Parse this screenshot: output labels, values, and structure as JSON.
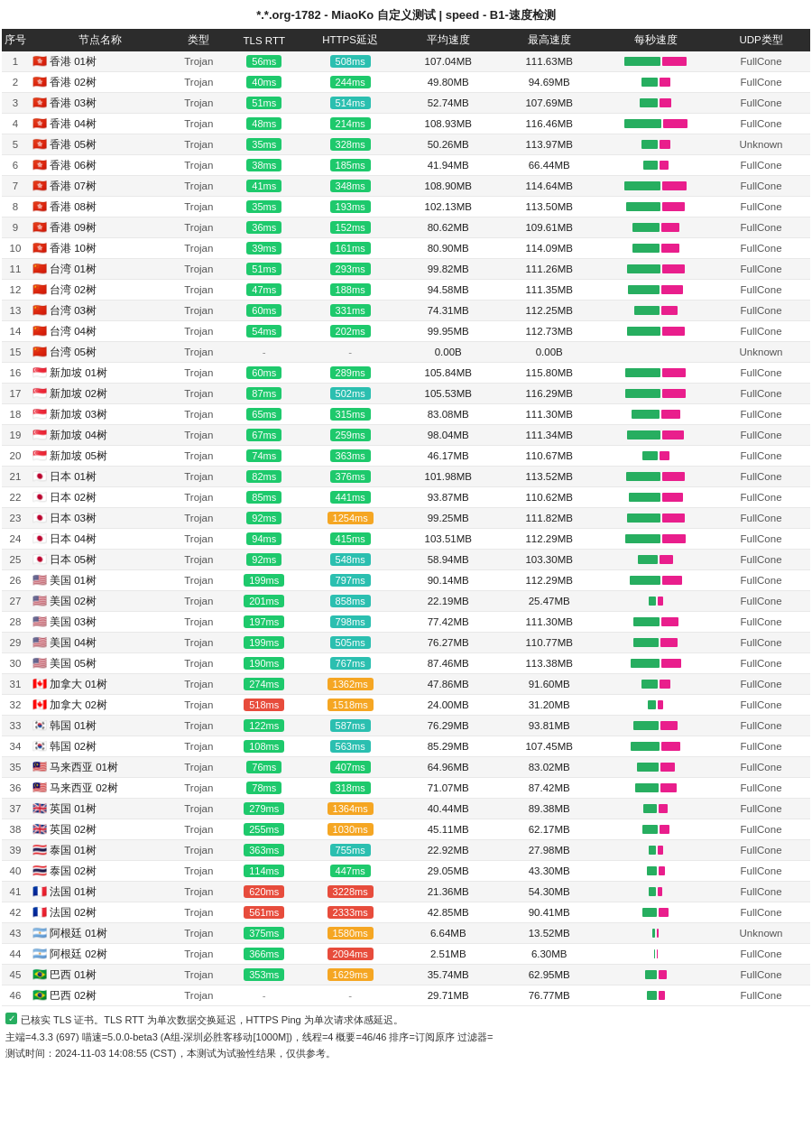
{
  "title": "*.*.org-1782 - MiaoKo 自定义测试 | speed - B1-速度检测",
  "columns": [
    "序号",
    "节点名称",
    "类型",
    "TLS RTT",
    "HTTPS延迟",
    "平均速度",
    "最高速度",
    "每秒速度",
    "UDP类型"
  ],
  "rows": [
    {
      "index": 1,
      "flag": "🇭🇰",
      "name": "香港 01树",
      "type": "Trojan",
      "tls": "56ms",
      "tlsColor": "green",
      "https": "508ms",
      "httpsColor": "teal",
      "avg": "107.04MB",
      "max": "111.63MB",
      "udp": "FullCone",
      "speedRatio": 0.95
    },
    {
      "index": 2,
      "flag": "🇭🇰",
      "name": "香港 02树",
      "type": "Trojan",
      "tls": "40ms",
      "tlsColor": "green",
      "https": "244ms",
      "httpsColor": "green",
      "avg": "49.80MB",
      "max": "94.69MB",
      "udp": "FullCone",
      "speedRatio": 0.43
    },
    {
      "index": 3,
      "flag": "🇭🇰",
      "name": "香港 03树",
      "type": "Trojan",
      "tls": "51ms",
      "tlsColor": "green",
      "https": "514ms",
      "httpsColor": "teal",
      "avg": "52.74MB",
      "max": "107.69MB",
      "udp": "FullCone",
      "speedRatio": 0.47
    },
    {
      "index": 4,
      "flag": "🇭🇰",
      "name": "香港 04树",
      "type": "Trojan",
      "tls": "48ms",
      "tlsColor": "green",
      "https": "214ms",
      "httpsColor": "green",
      "avg": "108.93MB",
      "max": "116.46MB",
      "udp": "FullCone",
      "speedRatio": 0.97
    },
    {
      "index": 5,
      "flag": "🇭🇰",
      "name": "香港 05树",
      "type": "Trojan",
      "tls": "35ms",
      "tlsColor": "green",
      "https": "328ms",
      "httpsColor": "green",
      "avg": "50.26MB",
      "max": "113.97MB",
      "udp": "Unknown",
      "speedRatio": 0.44
    },
    {
      "index": 6,
      "flag": "🇭🇰",
      "name": "香港 06树",
      "type": "Trojan",
      "tls": "38ms",
      "tlsColor": "green",
      "https": "185ms",
      "httpsColor": "green",
      "avg": "41.94MB",
      "max": "66.44MB",
      "udp": "FullCone",
      "speedRatio": 0.37
    },
    {
      "index": 7,
      "flag": "🇭🇰",
      "name": "香港 07树",
      "type": "Trojan",
      "tls": "41ms",
      "tlsColor": "green",
      "https": "348ms",
      "httpsColor": "green",
      "avg": "108.90MB",
      "max": "114.64MB",
      "udp": "FullCone",
      "speedRatio": 0.96
    },
    {
      "index": 8,
      "flag": "🇭🇰",
      "name": "香港 08树",
      "type": "Trojan",
      "tls": "35ms",
      "tlsColor": "green",
      "https": "193ms",
      "httpsColor": "green",
      "avg": "102.13MB",
      "max": "113.50MB",
      "udp": "FullCone",
      "speedRatio": 0.9
    },
    {
      "index": 9,
      "flag": "🇭🇰",
      "name": "香港 09树",
      "type": "Trojan",
      "tls": "36ms",
      "tlsColor": "green",
      "https": "152ms",
      "httpsColor": "green",
      "avg": "80.62MB",
      "max": "109.61MB",
      "udp": "FullCone",
      "speedRatio": 0.71
    },
    {
      "index": 10,
      "flag": "🇭🇰",
      "name": "香港 10树",
      "type": "Trojan",
      "tls": "39ms",
      "tlsColor": "green",
      "https": "161ms",
      "httpsColor": "green",
      "avg": "80.90MB",
      "max": "114.09MB",
      "udp": "FullCone",
      "speedRatio": 0.72
    },
    {
      "index": 11,
      "flag": "🇨🇳",
      "name": "台湾 01树",
      "type": "Trojan",
      "tls": "51ms",
      "tlsColor": "green",
      "https": "293ms",
      "httpsColor": "green",
      "avg": "99.82MB",
      "max": "111.26MB",
      "udp": "FullCone",
      "speedRatio": 0.88
    },
    {
      "index": 12,
      "flag": "🇨🇳",
      "name": "台湾 02树",
      "type": "Trojan",
      "tls": "47ms",
      "tlsColor": "green",
      "https": "188ms",
      "httpsColor": "green",
      "avg": "94.58MB",
      "max": "111.35MB",
      "udp": "FullCone",
      "speedRatio": 0.84
    },
    {
      "index": 13,
      "flag": "🇨🇳",
      "name": "台湾 03树",
      "type": "Trojan",
      "tls": "60ms",
      "tlsColor": "green",
      "https": "331ms",
      "httpsColor": "green",
      "avg": "74.31MB",
      "max": "112.25MB",
      "udp": "FullCone",
      "speedRatio": 0.66
    },
    {
      "index": 14,
      "flag": "🇨🇳",
      "name": "台湾 04树",
      "type": "Trojan",
      "tls": "54ms",
      "tlsColor": "green",
      "https": "202ms",
      "httpsColor": "green",
      "avg": "99.95MB",
      "max": "112.73MB",
      "udp": "FullCone",
      "speedRatio": 0.89
    },
    {
      "index": 15,
      "flag": "🇨🇳",
      "name": "台湾 05树",
      "type": "Trojan",
      "tls": "-",
      "tlsColor": "dash",
      "https": "-",
      "httpsColor": "dash",
      "avg": "0.00B",
      "max": "0.00B",
      "udp": "Unknown",
      "speedRatio": 0
    },
    {
      "index": 16,
      "flag": "🇸🇬",
      "name": "新加坡 01树",
      "type": "Trojan",
      "tls": "60ms",
      "tlsColor": "green",
      "https": "289ms",
      "httpsColor": "green",
      "avg": "105.84MB",
      "max": "115.80MB",
      "udp": "FullCone",
      "speedRatio": 0.94
    },
    {
      "index": 17,
      "flag": "🇸🇬",
      "name": "新加坡 02树",
      "type": "Trojan",
      "tls": "87ms",
      "tlsColor": "green",
      "https": "502ms",
      "httpsColor": "teal",
      "avg": "105.53MB",
      "max": "116.29MB",
      "udp": "FullCone",
      "speedRatio": 0.93
    },
    {
      "index": 18,
      "flag": "🇸🇬",
      "name": "新加坡 03树",
      "type": "Trojan",
      "tls": "65ms",
      "tlsColor": "green",
      "https": "315ms",
      "httpsColor": "green",
      "avg": "83.08MB",
      "max": "111.30MB",
      "udp": "FullCone",
      "speedRatio": 0.74
    },
    {
      "index": 19,
      "flag": "🇸🇬",
      "name": "新加坡 04树",
      "type": "Trojan",
      "tls": "67ms",
      "tlsColor": "green",
      "https": "259ms",
      "httpsColor": "green",
      "avg": "98.04MB",
      "max": "111.34MB",
      "udp": "FullCone",
      "speedRatio": 0.87
    },
    {
      "index": 20,
      "flag": "🇸🇬",
      "name": "新加坡 05树",
      "type": "Trojan",
      "tls": "74ms",
      "tlsColor": "green",
      "https": "363ms",
      "httpsColor": "green",
      "avg": "46.17MB",
      "max": "110.67MB",
      "udp": "FullCone",
      "speedRatio": 0.41
    },
    {
      "index": 21,
      "flag": "🇯🇵",
      "name": "日本 01树",
      "type": "Trojan",
      "tls": "82ms",
      "tlsColor": "green",
      "https": "376ms",
      "httpsColor": "green",
      "avg": "101.98MB",
      "max": "113.52MB",
      "udp": "FullCone",
      "speedRatio": 0.9
    },
    {
      "index": 22,
      "flag": "🇯🇵",
      "name": "日本 02树",
      "type": "Trojan",
      "tls": "85ms",
      "tlsColor": "green",
      "https": "441ms",
      "httpsColor": "green",
      "avg": "93.87MB",
      "max": "110.62MB",
      "udp": "FullCone",
      "speedRatio": 0.83
    },
    {
      "index": 23,
      "flag": "🇯🇵",
      "name": "日本 03树",
      "type": "Trojan",
      "tls": "92ms",
      "tlsColor": "green",
      "https": "1254ms",
      "httpsColor": "orange",
      "avg": "99.25MB",
      "max": "111.82MB",
      "udp": "FullCone",
      "speedRatio": 0.88
    },
    {
      "index": 24,
      "flag": "🇯🇵",
      "name": "日本 04树",
      "type": "Trojan",
      "tls": "94ms",
      "tlsColor": "green",
      "https": "415ms",
      "httpsColor": "green",
      "avg": "103.51MB",
      "max": "112.29MB",
      "udp": "FullCone",
      "speedRatio": 0.92
    },
    {
      "index": 25,
      "flag": "🇯🇵",
      "name": "日本 05树",
      "type": "Trojan",
      "tls": "92ms",
      "tlsColor": "green",
      "https": "548ms",
      "httpsColor": "teal",
      "avg": "58.94MB",
      "max": "103.30MB",
      "udp": "FullCone",
      "speedRatio": 0.52
    },
    {
      "index": 26,
      "flag": "🇺🇸",
      "name": "美国 01树",
      "type": "Trojan",
      "tls": "199ms",
      "tlsColor": "green",
      "https": "797ms",
      "httpsColor": "teal",
      "avg": "90.14MB",
      "max": "112.29MB",
      "udp": "FullCone",
      "speedRatio": 0.8
    },
    {
      "index": 27,
      "flag": "🇺🇸",
      "name": "美国 02树",
      "type": "Trojan",
      "tls": "201ms",
      "tlsColor": "green",
      "https": "858ms",
      "httpsColor": "teal",
      "avg": "22.19MB",
      "max": "25.47MB",
      "udp": "FullCone",
      "speedRatio": 0.2
    },
    {
      "index": 28,
      "flag": "🇺🇸",
      "name": "美国 03树",
      "type": "Trojan",
      "tls": "197ms",
      "tlsColor": "green",
      "https": "798ms",
      "httpsColor": "teal",
      "avg": "77.42MB",
      "max": "111.30MB",
      "udp": "FullCone",
      "speedRatio": 0.68
    },
    {
      "index": 29,
      "flag": "🇺🇸",
      "name": "美国 04树",
      "type": "Trojan",
      "tls": "199ms",
      "tlsColor": "green",
      "https": "505ms",
      "httpsColor": "teal",
      "avg": "76.27MB",
      "max": "110.77MB",
      "udp": "FullCone",
      "speedRatio": 0.67
    },
    {
      "index": 30,
      "flag": "🇺🇸",
      "name": "美国 05树",
      "type": "Trojan",
      "tls": "190ms",
      "tlsColor": "green",
      "https": "767ms",
      "httpsColor": "teal",
      "avg": "87.46MB",
      "max": "113.38MB",
      "udp": "FullCone",
      "speedRatio": 0.77
    },
    {
      "index": 31,
      "flag": "🇨🇦",
      "name": "加拿大 01树",
      "type": "Trojan",
      "tls": "274ms",
      "tlsColor": "green",
      "https": "1362ms",
      "httpsColor": "orange",
      "avg": "47.86MB",
      "max": "91.60MB",
      "udp": "FullCone",
      "speedRatio": 0.42
    },
    {
      "index": 32,
      "flag": "🇨🇦",
      "name": "加拿大 02树",
      "type": "Trojan",
      "tls": "518ms",
      "tlsColor": "red",
      "https": "1518ms",
      "httpsColor": "orange",
      "avg": "24.00MB",
      "max": "31.20MB",
      "udp": "FullCone",
      "speedRatio": 0.21
    },
    {
      "index": 33,
      "flag": "🇰🇷",
      "name": "韩国 01树",
      "type": "Trojan",
      "tls": "122ms",
      "tlsColor": "green",
      "https": "587ms",
      "httpsColor": "teal",
      "avg": "76.29MB",
      "max": "93.81MB",
      "udp": "FullCone",
      "speedRatio": 0.67
    },
    {
      "index": 34,
      "flag": "🇰🇷",
      "name": "韩国 02树",
      "type": "Trojan",
      "tls": "108ms",
      "tlsColor": "green",
      "https": "563ms",
      "httpsColor": "teal",
      "avg": "85.29MB",
      "max": "107.45MB",
      "udp": "FullCone",
      "speedRatio": 0.75
    },
    {
      "index": 35,
      "flag": "🇲🇾",
      "name": "马来西亚 01树",
      "type": "Trojan",
      "tls": "76ms",
      "tlsColor": "green",
      "https": "407ms",
      "httpsColor": "green",
      "avg": "64.96MB",
      "max": "83.02MB",
      "udp": "FullCone",
      "speedRatio": 0.57
    },
    {
      "index": 36,
      "flag": "🇲🇾",
      "name": "马来西亚 02树",
      "type": "Trojan",
      "tls": "78ms",
      "tlsColor": "green",
      "https": "318ms",
      "httpsColor": "green",
      "avg": "71.07MB",
      "max": "87.42MB",
      "udp": "FullCone",
      "speedRatio": 0.63
    },
    {
      "index": 37,
      "flag": "🇬🇧",
      "name": "英国 01树",
      "type": "Trojan",
      "tls": "279ms",
      "tlsColor": "green",
      "https": "1364ms",
      "httpsColor": "orange",
      "avg": "40.44MB",
      "max": "89.38MB",
      "udp": "FullCone",
      "speedRatio": 0.36
    },
    {
      "index": 38,
      "flag": "🇬🇧",
      "name": "英国 02树",
      "type": "Trojan",
      "tls": "255ms",
      "tlsColor": "green",
      "https": "1030ms",
      "httpsColor": "orange",
      "avg": "45.11MB",
      "max": "62.17MB",
      "udp": "FullCone",
      "speedRatio": 0.4
    },
    {
      "index": 39,
      "flag": "🇹🇭",
      "name": "泰国 01树",
      "type": "Trojan",
      "tls": "363ms",
      "tlsColor": "green",
      "https": "755ms",
      "httpsColor": "teal",
      "avg": "22.92MB",
      "max": "27.98MB",
      "udp": "FullCone",
      "speedRatio": 0.2
    },
    {
      "index": 40,
      "flag": "🇹🇭",
      "name": "泰国 02树",
      "type": "Trojan",
      "tls": "114ms",
      "tlsColor": "green",
      "https": "447ms",
      "httpsColor": "green",
      "avg": "29.05MB",
      "max": "43.30MB",
      "udp": "FullCone",
      "speedRatio": 0.26
    },
    {
      "index": 41,
      "flag": "🇫🇷",
      "name": "法国 01树",
      "type": "Trojan",
      "tls": "620ms",
      "tlsColor": "red",
      "https": "3228ms",
      "httpsColor": "red",
      "avg": "21.36MB",
      "max": "54.30MB",
      "udp": "FullCone",
      "speedRatio": 0.19
    },
    {
      "index": 42,
      "flag": "🇫🇷",
      "name": "法国 02树",
      "type": "Trojan",
      "tls": "561ms",
      "tlsColor": "red",
      "https": "2333ms",
      "httpsColor": "red",
      "avg": "42.85MB",
      "max": "90.41MB",
      "udp": "FullCone",
      "speedRatio": 0.38
    },
    {
      "index": 43,
      "flag": "🇦🇷",
      "name": "阿根廷 01树",
      "type": "Trojan",
      "tls": "375ms",
      "tlsColor": "green",
      "https": "1580ms",
      "httpsColor": "orange",
      "avg": "6.64MB",
      "max": "13.52MB",
      "udp": "Unknown",
      "speedRatio": 0.06
    },
    {
      "index": 44,
      "flag": "🇦🇷",
      "name": "阿根廷 02树",
      "type": "Trojan",
      "tls": "366ms",
      "tlsColor": "green",
      "https": "2094ms",
      "httpsColor": "red",
      "avg": "2.51MB",
      "max": "6.30MB",
      "udp": "FullCone",
      "speedRatio": 0.02
    },
    {
      "index": 45,
      "flag": "🇧🇷",
      "name": "巴西 01树",
      "type": "Trojan",
      "tls": "353ms",
      "tlsColor": "green",
      "https": "1629ms",
      "httpsColor": "orange",
      "avg": "35.74MB",
      "max": "62.95MB",
      "udp": "FullCone",
      "speedRatio": 0.32
    },
    {
      "index": 46,
      "flag": "🇧🇷",
      "name": "巴西 02树",
      "type": "Trojan",
      "tls": "-",
      "tlsColor": "dash",
      "https": "-",
      "httpsColor": "dash",
      "avg": "29.71MB",
      "max": "76.77MB",
      "udp": "FullCone",
      "speedRatio": 0.26
    }
  ],
  "footer": {
    "line1": "✓ 已核实 TLS 证书。TLS RTT 为单次数据交换延迟，HTTPS Ping 为单次请求体感延迟。",
    "line2": "主端=4.3.3 (697) 喵速=5.0.0-beta3 (A组-深圳必胜客移动[1000M])，线程=4 概要=46/46 排序=订阅原序 过滤器=",
    "line3": "测试时间：2024-11-03 14:08:55 (CST)，本测试为试验性结果，仅供参考。"
  }
}
